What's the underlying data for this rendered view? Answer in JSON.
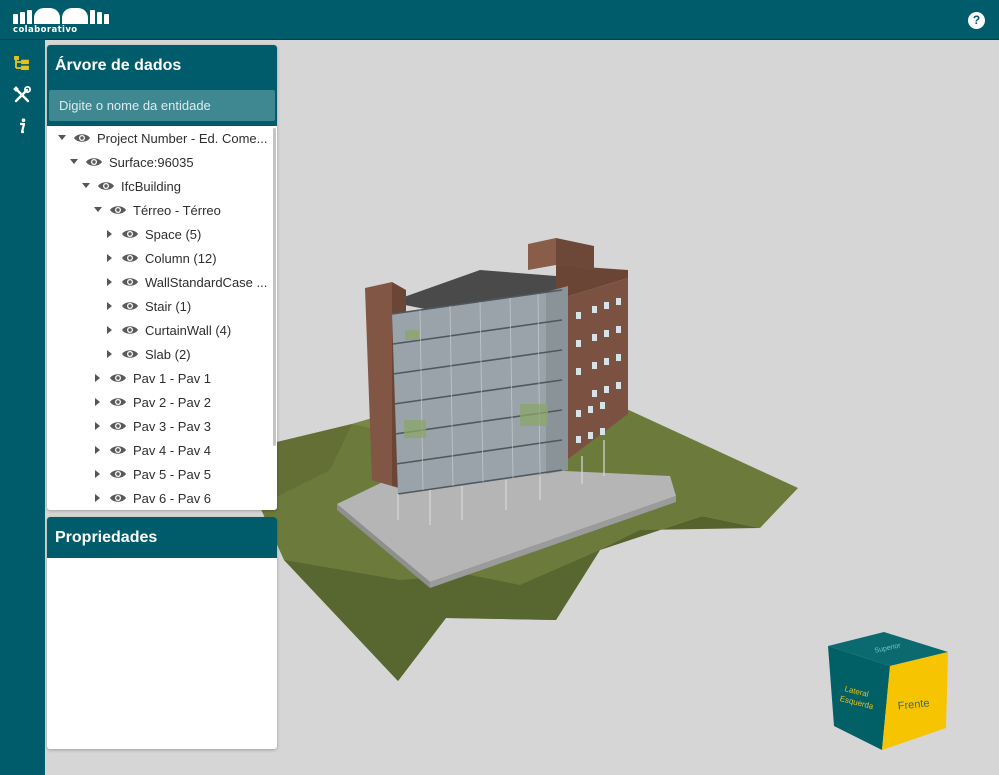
{
  "header": {
    "logo_text": "colaborativo",
    "help_label": "?"
  },
  "rail": {
    "buttons": [
      {
        "name": "tree-icon",
        "active": true
      },
      {
        "name": "tools-icon",
        "active": false
      },
      {
        "name": "info-icon",
        "active": false
      }
    ],
    "active_color": "#e8c21c"
  },
  "tree_panel": {
    "title": "Árvore de dados",
    "search_placeholder": "Digite o nome da entidade",
    "items": [
      {
        "label": "Project Number - Ed. Come...",
        "level": 0,
        "expanded": true
      },
      {
        "label": "Surface:96035",
        "level": 1,
        "expanded": true
      },
      {
        "label": "IfcBuilding",
        "level": 2,
        "expanded": true
      },
      {
        "label": "Térreo - Térreo",
        "level": 3,
        "expanded": true
      },
      {
        "label": "Space (5)",
        "level": 4,
        "expanded": false
      },
      {
        "label": "Column (12)",
        "level": 4,
        "expanded": false
      },
      {
        "label": "WallStandardCase ...",
        "level": 4,
        "expanded": false
      },
      {
        "label": "Stair (1)",
        "level": 4,
        "expanded": false
      },
      {
        "label": "CurtainWall (4)",
        "level": 4,
        "expanded": false
      },
      {
        "label": "Slab (2)",
        "level": 4,
        "expanded": false
      },
      {
        "label": "Pav 1 - Pav 1",
        "level": 3,
        "expanded": false
      },
      {
        "label": "Pav 2 - Pav 2",
        "level": 3,
        "expanded": false
      },
      {
        "label": "Pav 3 - Pav 3",
        "level": 3,
        "expanded": false
      },
      {
        "label": "Pav 4 - Pav 4",
        "level": 3,
        "expanded": false
      },
      {
        "label": "Pav 5 - Pav 5",
        "level": 3,
        "expanded": false
      },
      {
        "label": "Pav 6 - Pav 6",
        "level": 3,
        "expanded": false
      }
    ]
  },
  "properties_panel": {
    "title": "Propriedades"
  },
  "navcube": {
    "top_label": "Superior",
    "left_label_line1": "Lateral",
    "left_label_line2": "Esquerda",
    "front_label": "Frente",
    "front_color": "#f6c400",
    "side_color": "#006066"
  },
  "colors": {
    "brand": "#005c6a",
    "viewport_background": "#d6d6d6",
    "terrain": "#6b7a3a",
    "brick": "#7d5443",
    "slab": "#b3b3b3"
  }
}
